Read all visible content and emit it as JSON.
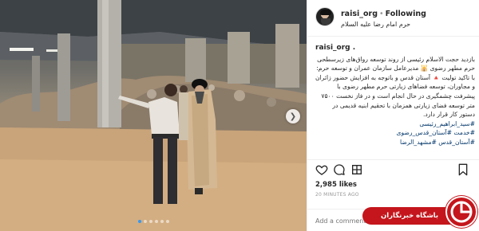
{
  "post": {
    "username": "raisi_org",
    "follow_label": "Following",
    "separator": "•",
    "location": "حرم امام رضا علیه السلام",
    "avatar_icon": "profile-avatar",
    "caption": {
      "username": "raisi_org .",
      "text": "بازدید حجت الاسلام رئیسی از روند توسعه رواق‌های زیرسطحی حرم مطهر رضوی 🕌 مدیرعامل سازمان عمران و توسعه حرم: با تاکید تولیت 🔺 آستان قدس و باتوجه به افزایش حضور زائران و مجاوران، توسعه فضاهای زیارتی حرم مطهر رضوی با پیشرفت چشمگیری در حال انجام است و در فاز نخست ۷۵۰۰ متر توسعه فضای زیارتی همزمان با تحقیم ابنیه قدیمی در دستور کار قرار دارد.",
      "hashtags": [
        "#سید_ابراهیم_رئیسی",
        "#خدمت #آستان_قدس_رضوی",
        "#آستان_قدس #مشهد_الرضا"
      ]
    },
    "likes": "2,985 likes",
    "timestamp": "20 MINUTES AGO",
    "comment_placeholder": "Add a comment...",
    "carousel": {
      "total_slides": 6,
      "active_index": 0
    },
    "icons": [
      "heart-icon",
      "comment-icon",
      "share-icon",
      "bookmark-icon",
      "chevron-right-icon"
    ]
  },
  "watermark": {
    "text": "باشگاه خبرنگاران"
  },
  "colors": {
    "link": "#003569",
    "accent": "#3897f0",
    "watermark": "#c4161c"
  }
}
